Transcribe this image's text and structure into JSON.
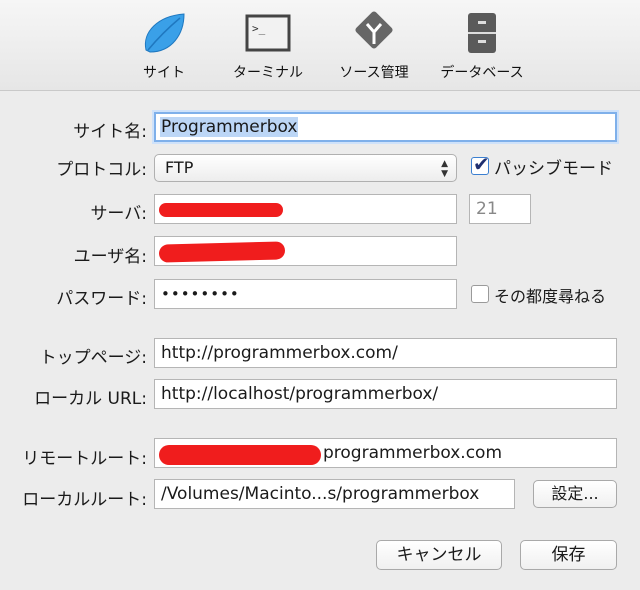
{
  "toolbar": {
    "items": [
      {
        "label": "サイト",
        "icon": "leaf-icon"
      },
      {
        "label": "ターミナル",
        "icon": "terminal-icon"
      },
      {
        "label": "ソース管理",
        "icon": "source-control-icon"
      },
      {
        "label": "データベース",
        "icon": "database-icon"
      }
    ]
  },
  "form": {
    "site_name_label": "サイト名:",
    "site_name_value": "Programmerbox",
    "protocol_label": "プロトコル:",
    "protocol_value": "FTP",
    "passive_label": "パッシブモード",
    "passive_checked": true,
    "server_label": "サーバ:",
    "port_value": "21",
    "user_label": "ユーザ名:",
    "password_label": "パスワード:",
    "password_value": "••••••••",
    "ask_every_time_label": "その都度尋ねる",
    "ask_every_time_checked": false,
    "top_page_label": "トップページ:",
    "top_page_value": "http://programmerbox.com/",
    "local_url_label": "ローカル URL:",
    "local_url_value": "http://localhost/programmerbox/",
    "remote_root_label": "リモートルート:",
    "remote_root_suffix": "programmerbox.com",
    "local_root_label": "ローカルルート:",
    "local_root_value": "/Volumes/Macinto...s/programmerbox",
    "settings_button": "設定..."
  },
  "buttons": {
    "cancel": "キャンセル",
    "save": "保存"
  },
  "colors": {
    "redaction": "#f01d1d",
    "focus_ring": "#7fb0ea",
    "leaf": "#3aa0e8"
  }
}
